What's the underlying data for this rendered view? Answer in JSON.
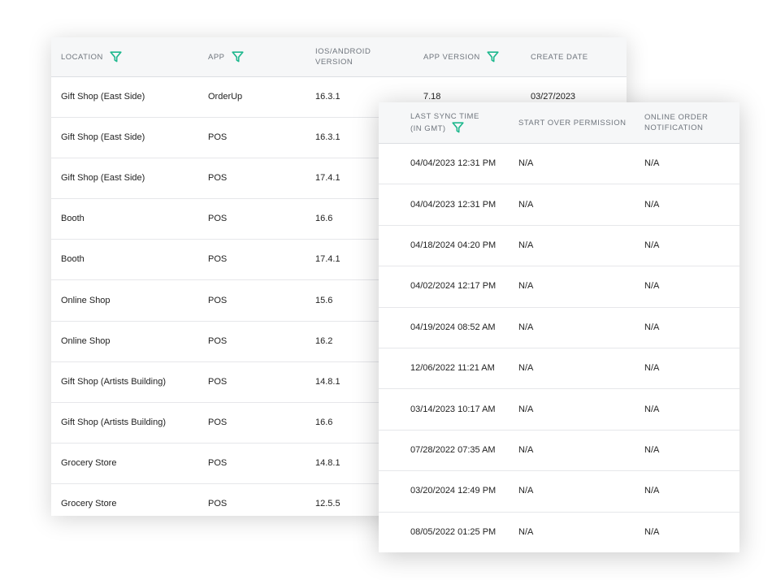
{
  "back_table": {
    "headers": {
      "location": "LOCATION",
      "app": "APP",
      "os_version": "IOS/ANDROID VERSION",
      "app_version": "APP VERSION",
      "create_date": "CREATE DATE"
    },
    "rows": [
      {
        "location": "Gift Shop (East Side)",
        "app": "OrderUp",
        "os_version": "16.3.1",
        "app_version": "7.18",
        "create_date": "03/27/2023"
      },
      {
        "location": "Gift Shop (East Side)",
        "app": "POS",
        "os_version": "16.3.1",
        "app_version": "",
        "create_date": ""
      },
      {
        "location": "Gift Shop (East Side)",
        "app": "POS",
        "os_version": "17.4.1",
        "app_version": "",
        "create_date": ""
      },
      {
        "location": "Booth",
        "app": "POS",
        "os_version": "16.6",
        "app_version": "",
        "create_date": ""
      },
      {
        "location": "Booth",
        "app": "POS",
        "os_version": "17.4.1",
        "app_version": "",
        "create_date": ""
      },
      {
        "location": "Online Shop",
        "app": "POS",
        "os_version": "15.6",
        "app_version": "",
        "create_date": ""
      },
      {
        "location": "Online Shop",
        "app": "POS",
        "os_version": "16.2",
        "app_version": "",
        "create_date": ""
      },
      {
        "location": "Gift Shop (Artists Building)",
        "app": "POS",
        "os_version": "14.8.1",
        "app_version": "",
        "create_date": ""
      },
      {
        "location": "Gift Shop (Artists Building)",
        "app": "POS",
        "os_version": "16.6",
        "app_version": "",
        "create_date": ""
      },
      {
        "location": "Grocery Store",
        "app": "POS",
        "os_version": "14.8.1",
        "app_version": "",
        "create_date": ""
      },
      {
        "location": "Grocery Store",
        "app": "POS",
        "os_version": "12.5.5",
        "app_version": "",
        "create_date": ""
      }
    ]
  },
  "front_table": {
    "headers": {
      "last_sync": "LAST SYNC TIME (IN GMT)",
      "start_over": "START OVER PERMISSION",
      "online_order": "ONLINE ORDER NOTIFICATION"
    },
    "rows": [
      {
        "last_sync": "04/04/2023 12:31 PM",
        "start_over": "N/A",
        "online_order": "N/A"
      },
      {
        "last_sync": "04/04/2023 12:31 PM",
        "start_over": "N/A",
        "online_order": "N/A"
      },
      {
        "last_sync": "04/18/2024 04:20 PM",
        "start_over": "N/A",
        "online_order": "N/A"
      },
      {
        "last_sync": "04/02/2024 12:17 PM",
        "start_over": "N/A",
        "online_order": "N/A"
      },
      {
        "last_sync": "04/19/2024 08:52 AM",
        "start_over": "N/A",
        "online_order": "N/A"
      },
      {
        "last_sync": "12/06/2022 11:21 AM",
        "start_over": "N/A",
        "online_order": "N/A"
      },
      {
        "last_sync": "03/14/2023 10:17 AM",
        "start_over": "N/A",
        "online_order": "N/A"
      },
      {
        "last_sync": "07/28/2022 07:35 AM",
        "start_over": "N/A",
        "online_order": "N/A"
      },
      {
        "last_sync": "03/20/2024 12:49 PM",
        "start_over": "N/A",
        "online_order": "N/A"
      },
      {
        "last_sync": "08/05/2022 01:25 PM",
        "start_over": "N/A",
        "online_order": "N/A"
      }
    ]
  },
  "icons": {
    "filter": "filter-funnel-icon"
  },
  "colors": {
    "accent": "#1fb88e",
    "header_bg": "#f6f7f8",
    "header_text": "#6f757d",
    "row_border": "#e6e7ea"
  }
}
